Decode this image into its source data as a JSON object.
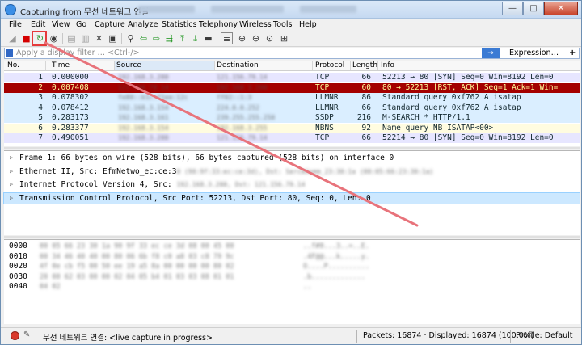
{
  "window": {
    "title": "Capturing from 무선 네트워크 연결",
    "min": "—",
    "max": "□",
    "close": "✕"
  },
  "menu": [
    "File",
    "Edit",
    "View",
    "Go",
    "Capture",
    "Analyze",
    "Statistics",
    "Telephony",
    "Wireless",
    "Tools",
    "Help"
  ],
  "filter": {
    "placeholder": "Apply a display filter … <Ctrl-/>",
    "apply": "→",
    "expression": "Expression…",
    "plus": "+"
  },
  "columns": {
    "no": "No.",
    "time": "Time",
    "source": "Source",
    "destination": "Destination",
    "protocol": "Protocol",
    "length": "Length",
    "info": "Info"
  },
  "packets": [
    {
      "no": "1",
      "time": "0.000000",
      "src": "192.168.3.200",
      "dst": "121.156.79.14",
      "proto": "TCP",
      "len": "66",
      "info": "52213 → 80 [SYN] Seq=0 Win=8192 Len=0",
      "bg": "#e7e6ff",
      "fg": "#12272e"
    },
    {
      "no": "2",
      "time": "0.007408",
      "src": "121.156.79.14",
      "dst": "192.168.3.200",
      "proto": "TCP",
      "len": "60",
      "info": "80 → 52213 [RST, ACK] Seq=1 Ack=1 Win=",
      "bg": "#a40000",
      "fg": "#fffc9c"
    },
    {
      "no": "3",
      "time": "0.078302",
      "src": "fe80::b1c:f1ee:12c",
      "dst": "ff02::1:3",
      "proto": "LLMNR",
      "len": "86",
      "info": "Standard query 0xf762 A isatap",
      "bg": "#daeeff",
      "fg": "#12272e"
    },
    {
      "no": "4",
      "time": "0.078412",
      "src": "192.168.3.154",
      "dst": "224.0.0.252",
      "proto": "LLMNR",
      "len": "66",
      "info": "Standard query 0xf762 A isatap",
      "bg": "#daeeff",
      "fg": "#12272e"
    },
    {
      "no": "5",
      "time": "0.283173",
      "src": "192.168.3.161",
      "dst": "239.255.255.250",
      "proto": "SSDP",
      "len": "216",
      "info": "M-SEARCH * HTTP/1.1",
      "bg": "#daeeff",
      "fg": "#12272e"
    },
    {
      "no": "6",
      "time": "0.283377",
      "src": "192.168.3.154",
      "dst": "192.168.3.255",
      "proto": "NBNS",
      "len": "92",
      "info": "Name query NB ISATAP<00>",
      "bg": "#fffce0",
      "fg": "#12272e"
    },
    {
      "no": "7",
      "time": "0.490051",
      "src": "192.168.3.200",
      "dst": "121.156.79.14",
      "proto": "TCP",
      "len": "66",
      "info": "52214 → 80 [SYN] Seq=0 Win=8192 Len=0",
      "bg": "#e7e6ff",
      "fg": "#12272e"
    }
  ],
  "details": [
    {
      "prefix": "Frame 1: 66 bytes on wire (528 bits), 66 bytes captured (528 bits) on interface 0",
      "hidden": "",
      "sel": false
    },
    {
      "prefix": "Ethernet II, Src: EfmNetwo_ec:ce:3",
      "hidden": "0 (90:9f:33:ec:ce:3d), Dst: SercmComm_23:30:1a (00:05:66:23:30:1a)",
      "sel": false
    },
    {
      "prefix": "Internet Protocol Version 4, Src: ",
      "hidden": "192.168.3.200, Dst: 121.156.79.14",
      "sel": false
    },
    {
      "prefix": "Transmission Control Protocol, Src Port: 52213, Dst Port: 80, Seq: 0, Len: 0",
      "hidden": "",
      "sel": true
    }
  ],
  "hex": [
    {
      "off": "0000",
      "bytes": "00 05 66 23 30 1a 90 9f 33 ec ce 3d 08 00 45 00",
      "ascii": "..f#0...3..=..E."
    },
    {
      "off": "0010",
      "bytes": "00 34 46 40 40 00 80 06 6b f8 c0 a8 03 c8 79 9c",
      "ascii": ".4F@@...k.....y."
    },
    {
      "off": "0020",
      "bytes": "4f 0e cb f5 00 50 ee 19 a5 8a 00 00 00 00 80 02",
      "ascii": "O....P.........."
    },
    {
      "off": "0030",
      "bytes": "20 00 62 03 00 00 02 04 05 b4 01 03 03 08 01 01",
      "ascii": " .b............."
    },
    {
      "off": "0040",
      "bytes": "04 02",
      "ascii": ".."
    }
  ],
  "status": {
    "capture": "무선 네트워크 연결: <live capture in progress>",
    "packets": "Packets: 16874 · Displayed: 16874 (100.0%)",
    "profile": "Profile: Default"
  }
}
